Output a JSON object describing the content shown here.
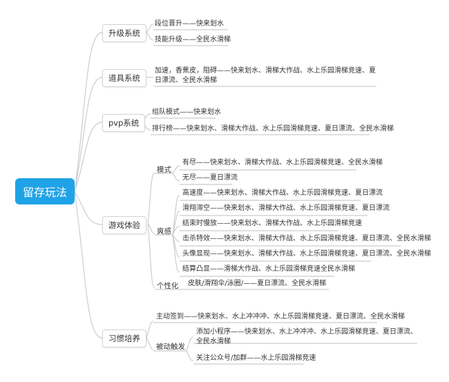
{
  "root": "留存玩法",
  "branches": [
    {
      "label": "升级系统",
      "items": [
        "段位晋升——快来划水",
        "技能升级——全民水滑梯"
      ]
    },
    {
      "label": "道具系统",
      "items": [
        "加速，香蕉皮，阻碍——快来划水、滑梯大作战、水上乐园滑梯竞速、夏日漂流、全民水滑梯"
      ]
    },
    {
      "label": "pvp系统",
      "items": [
        "组队模式——快来划水",
        "排行榜——快来划水、滑梯大作战、水上乐园滑梯竞速、夏日漂流、全民水滑梯"
      ]
    },
    {
      "label": "游戏体验",
      "groups": [
        {
          "label": "模式",
          "items": [
            "有尽——快来划水、滑梯大作战、水上乐园滑梯竞速、全民水滑梯",
            "无尽——夏日漂流"
          ]
        },
        {
          "label": "爽感",
          "items": [
            "高速度——快来划水、滑梯大作战、水上乐园滑梯竞速、夏日漂流",
            "滑翔滞空——快来划水、滑梯大作战、水上乐园滑梯竞速、夏日漂流",
            "结束时慢放——快来划水、滑梯大作战、水上乐园滑梯竞速",
            "击杀特效——快来划水、滑梯大作战、水上乐园滑梯竞速、夏日漂流、全民水滑梯",
            "头像显现——快来划水、滑梯大作战、水上乐园滑梯竞速、夏日漂流、全民水滑梯",
            "结算凸显——滑梯大作战、水上乐园滑梯竞速全民水滑梯"
          ]
        },
        {
          "label": "个性化",
          "items": [
            "皮肤/滑翔伞/泳圈/——夏日漂流、全民水滑梯"
          ]
        }
      ]
    },
    {
      "label": "习惯培养",
      "groups": [
        {
          "label": "主动签到——快来划水、水上冲冲冲、水上乐园滑梯竞速、夏日漂流、全民水滑梯",
          "items": []
        },
        {
          "label": "被动触发",
          "items": [
            "添加小程序——快来划水、水上冲冲冲、水上乐园滑梯竞速、夏日漂流、全民水滑梯",
            "关注公众号/加群——水上乐园滑梯竞速"
          ]
        }
      ]
    }
  ]
}
